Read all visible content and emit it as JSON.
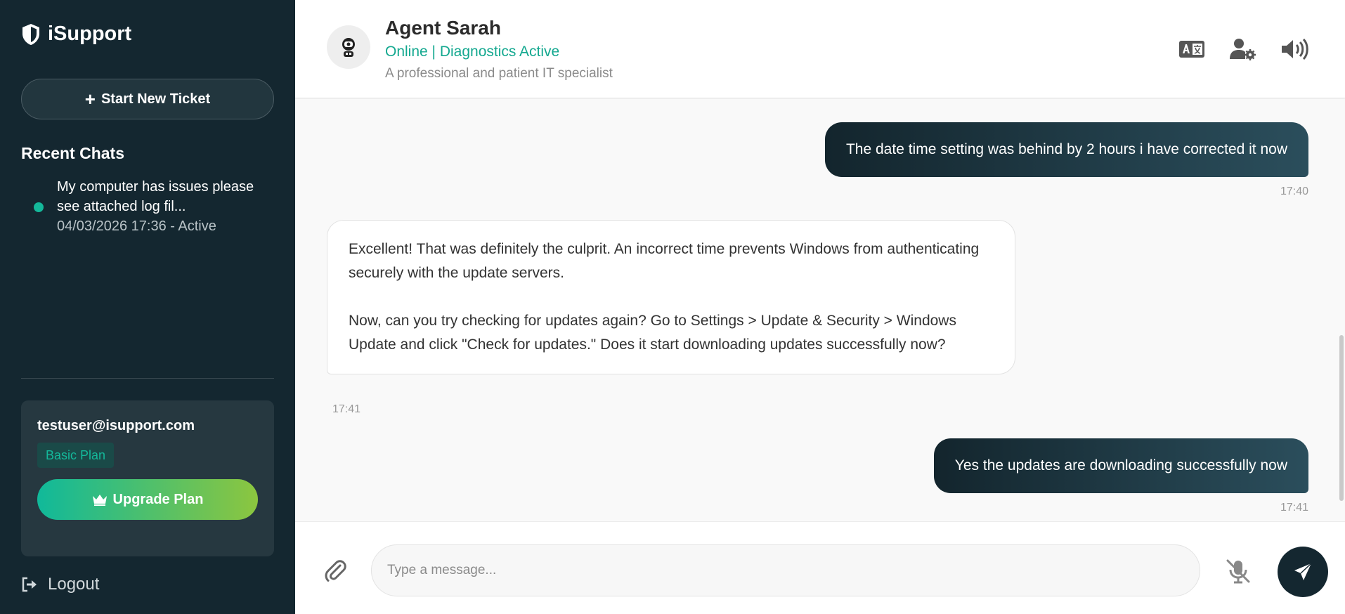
{
  "sidebar": {
    "brand": "iSupport",
    "new_ticket_label": "Start New Ticket",
    "recent_title": "Recent Chats",
    "chats": [
      {
        "title": "My computer has issues please see attached log fil...",
        "meta": "04/03/2026 17:36 - Active"
      }
    ],
    "account": {
      "email": "testuser@isupport.com",
      "plan": "Basic Plan",
      "upgrade_label": "Upgrade Plan"
    },
    "logout_label": "Logout"
  },
  "header": {
    "agent_name": "Agent Sarah",
    "status": "Online | Diagnostics Active",
    "description": "A professional and patient IT specialist"
  },
  "messages": [
    {
      "role": "user",
      "text": "The date time setting was behind by 2 hours i have corrected it now",
      "time": "17:40"
    },
    {
      "role": "agent",
      "paragraphs": [
        "Excellent! That was definitely the culprit. An incorrect time prevents Windows from authenticating securely with the update servers.",
        "Now, can you try checking for updates again? Go to Settings > Update & Security > Windows Update and click \"Check for updates.\" Does it start downloading updates successfully now?"
      ],
      "time": "17:41"
    },
    {
      "role": "user",
      "text": "Yes the updates are downloading successfully now",
      "time": "17:41"
    }
  ],
  "composer": {
    "placeholder": "Type a message..."
  },
  "colors": {
    "sidebar_bg": "#142730",
    "accent": "#14b89a",
    "upgrade_gradient_start": "#10b99a",
    "upgrade_gradient_end": "#8cc63f"
  },
  "icons": [
    "shield-icon",
    "plus-icon",
    "crown-icon",
    "logout-icon",
    "robot-icon",
    "translate-icon",
    "user-settings-icon",
    "volume-icon",
    "paperclip-icon",
    "mic-off-icon",
    "send-icon"
  ]
}
